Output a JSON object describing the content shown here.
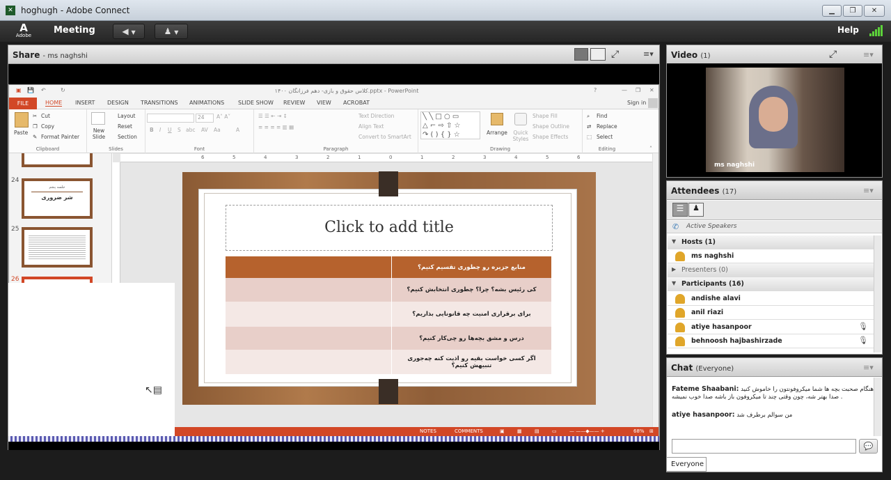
{
  "window": {
    "title": "hoghugh - Adobe Connect"
  },
  "topbar": {
    "logo_text": "Adobe",
    "meeting_label": "Meeting",
    "help_label": "Help"
  },
  "share_pod": {
    "title": "Share",
    "presenter": "- ms naghshi"
  },
  "powerpoint": {
    "title": "کلاس حقوق و بازی- دهم فرزانگان ۱۴۰۰.pptx - PowerPoint",
    "sign_in": "Sign in",
    "tabs": [
      "FILE",
      "HOME",
      "INSERT",
      "DESIGN",
      "TRANSITIONS",
      "ANIMATIONS",
      "SLIDE SHOW",
      "REVIEW",
      "VIEW",
      "ACROBAT"
    ],
    "ribbon": {
      "clipboard": {
        "label": "Clipboard",
        "paste": "Paste",
        "cut": "Cut",
        "copy": "Copy",
        "format_painter": "Format Painter"
      },
      "slides": {
        "label": "Slides",
        "new_slide": "New Slide",
        "layout": "Layout",
        "reset": "Reset",
        "section": "Section"
      },
      "font": {
        "label": "Font",
        "size": "24"
      },
      "paragraph": {
        "label": "Paragraph",
        "text_direction": "Text Direction",
        "align_text": "Align Text",
        "convert": "Convert to SmartArt"
      },
      "drawing": {
        "label": "Drawing",
        "arrange": "Arrange",
        "quick_styles": "Quick Styles",
        "shape_fill": "Shape Fill",
        "shape_outline": "Shape Outline",
        "shape_effects": "Shape Effects"
      },
      "editing": {
        "label": "Editing",
        "find": "Find",
        "replace": "Replace",
        "select": "Select"
      }
    },
    "thumbnails": [
      {
        "number": "24",
        "title": "شر ضروری",
        "subtitle": "جلسه پنجم"
      },
      {
        "number": "25"
      },
      {
        "number": "26"
      }
    ],
    "slide": {
      "title_placeholder": "Click to add title",
      "rows": [
        "منابع جزیره رو چطوری تقسیم کنیم؟",
        "کی رئیس بشه؟ چرا؟ چطوری انتخابش کنیم؟",
        "برای برقراری امنیت چه قانونایی بذاریم؟",
        "درس و مشق بچه‌ها رو چی‌کار کنیم؟",
        "اگر کسی خواست بقیه رو اذیت کنه چه‌جوری تنبیهش کنیم؟"
      ]
    },
    "status": {
      "notes": "NOTES",
      "comments": "COMMENTS",
      "zoom": "68%"
    },
    "ruler_numbers": [
      "6",
      "5",
      "4",
      "3",
      "2",
      "1",
      "0",
      "1",
      "2",
      "3",
      "4",
      "5",
      "6"
    ]
  },
  "video_pod": {
    "title": "Video",
    "count": "(1)",
    "name": "ms naghshi"
  },
  "attendees_pod": {
    "title": "Attendees",
    "count": "(17)",
    "active_speakers": "Active Speakers",
    "hosts": {
      "label": "Hosts (1)",
      "members": [
        "ms naghshi"
      ]
    },
    "presenters": {
      "label": "Presenters (0)"
    },
    "participants": {
      "label": "Participants (16)",
      "members": [
        "andishe alavi",
        "anil riazi",
        "atiye hasanpoor",
        "behnoosh hajbashirzade"
      ]
    }
  },
  "chat_pod": {
    "title": "Chat",
    "audience": "(Everyone)",
    "messages": [
      {
        "sender": "Fateme Shaabani:",
        "text": "هنگام صحبت بچه ها شما میکروفونتون را خاموش کنید . صدا بهتر شه، چون وقتی چند تا میکروفون باز باشه صدا خوب نمیشه"
      },
      {
        "sender": "atiye hasanpoor:",
        "text": "من سوالم برطرف شد"
      }
    ],
    "everyone_label": "Everyone"
  }
}
